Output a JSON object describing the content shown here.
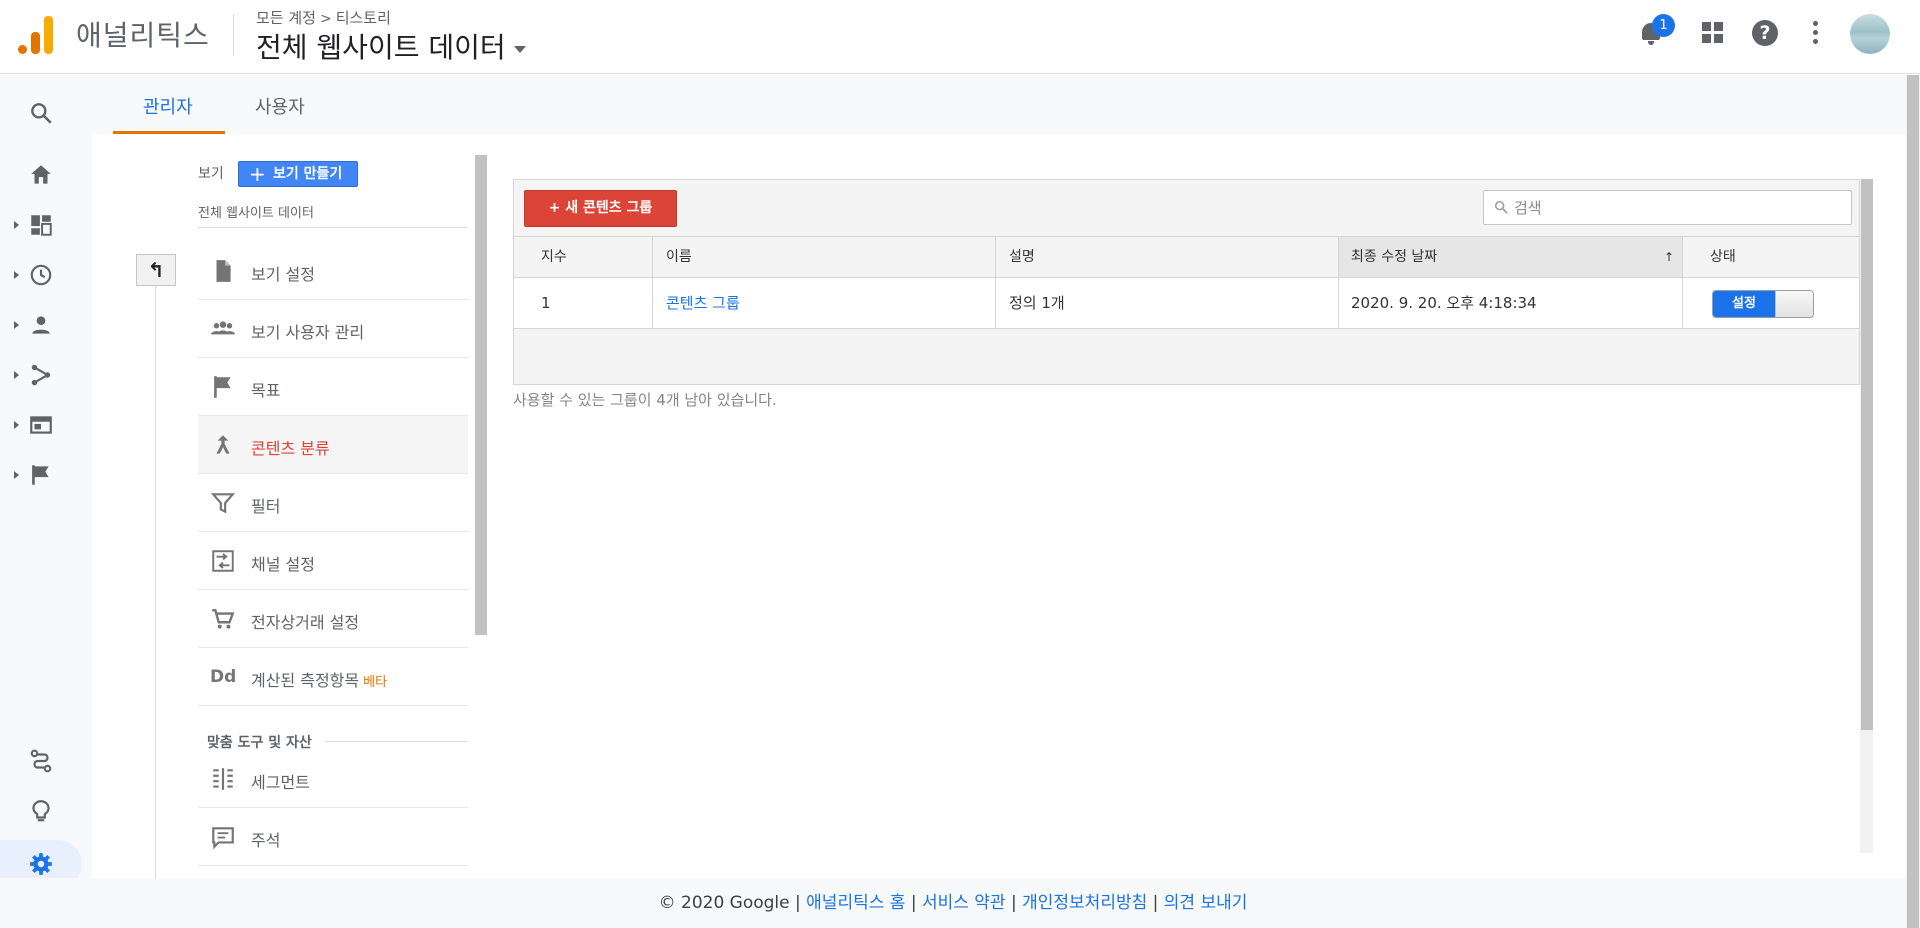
{
  "header": {
    "brand": "애널리틱스",
    "breadcrumb": {
      "account": "모든 계정",
      "property": "티스토리"
    },
    "view_name": "전체 웹사이트 데이터",
    "notification_count": "1",
    "help_glyph": "?"
  },
  "tabs": {
    "admin": "관리자",
    "user": "사용자"
  },
  "view_column": {
    "heading": "보기",
    "create_label": "보기 만들기",
    "view_name": "전체 웹사이트 데이터",
    "back_glyph": "↰",
    "items": [
      {
        "label": "보기 설정"
      },
      {
        "label": "보기 사용자 관리"
      },
      {
        "label": "목표"
      },
      {
        "label": "콘텐츠 분류"
      },
      {
        "label": "필터"
      },
      {
        "label": "채널 설정"
      },
      {
        "label": "전자상거래 설정"
      },
      {
        "label": "계산된 측정항목",
        "badge": "베타",
        "icon_text": "Dd"
      }
    ],
    "tools_heading": "맞춤 도구 및 자산",
    "tools_items": [
      {
        "label": "세그먼트"
      },
      {
        "label": "주석"
      }
    ]
  },
  "content_grouping": {
    "new_button": "+ 새 콘텐츠 그룹",
    "search_placeholder": "검색",
    "columns": {
      "index": "지수",
      "name": "이름",
      "description": "설명",
      "modified": "최종 수정 날짜",
      "status": "상태"
    },
    "sort_glyph": "↑",
    "rows": [
      {
        "index": "1",
        "name": "콘텐츠 그룹",
        "description": "정의 1개",
        "modified": "2020. 9. 20. 오후 4:18:34",
        "status_label": "설정"
      }
    ],
    "remaining": "사용할 수 있는 그룹이 4개 남아 있습니다."
  },
  "footer": {
    "copyright": "© 2020 Google",
    "links": [
      "애널리틱스 홈",
      "서비스 약관",
      "개인정보처리방침",
      "의견 보내기"
    ]
  },
  "colors": {
    "accent_blue": "#1a73e8",
    "accent_red": "#db4437",
    "accent_orange": "#e37400"
  }
}
